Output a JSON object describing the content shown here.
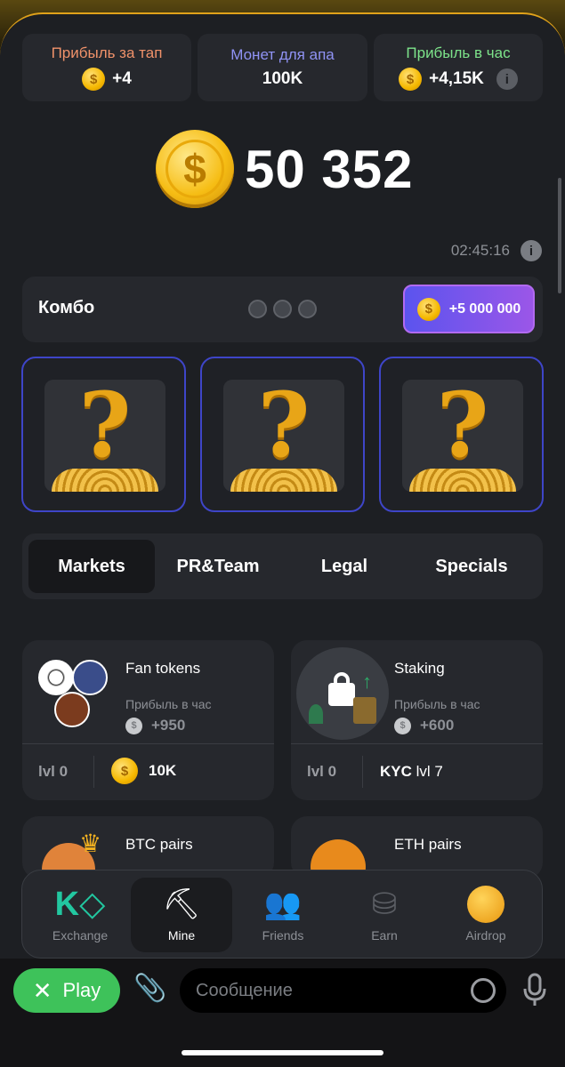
{
  "stats": [
    {
      "title": "Прибыль за тап",
      "value": "+4",
      "color": "#f0926a",
      "has_coin": true
    },
    {
      "title": "Монет для апа",
      "value": "100K",
      "color": "#9093f5",
      "has_coin": false
    },
    {
      "title": "Прибыль в час",
      "value": "+4,15K",
      "color": "#7de38a",
      "has_coin": true,
      "has_info": true
    }
  ],
  "balance": {
    "value": "50 352",
    "coin_symbol": "$"
  },
  "timer": {
    "value": "02:45:16",
    "info_icon": "i"
  },
  "combo": {
    "label": "Комбо",
    "reward": "+5 000 000",
    "slots_filled": 0,
    "slots_total": 3
  },
  "combo_cards": [
    {
      "symbol": "?"
    },
    {
      "symbol": "?"
    },
    {
      "symbol": "?"
    }
  ],
  "tabs": [
    {
      "label": "Markets",
      "active": true
    },
    {
      "label": "PR&Team",
      "active": false
    },
    {
      "label": "Legal",
      "active": false
    },
    {
      "label": "Specials",
      "active": false
    }
  ],
  "market_cards": [
    {
      "title": "Fan tokens",
      "profit_label": "Прибыль в час",
      "profit": "+950",
      "level": "lvl 0",
      "cost": "10K",
      "cost_type": "coin"
    },
    {
      "title": "Staking",
      "profit_label": "Прибыль в час",
      "profit": "+600",
      "level": "lvl 0",
      "requirement_bold": "KYC",
      "requirement": " lvl 7",
      "cost_type": "requirement"
    },
    {
      "title": "BTC pairs"
    },
    {
      "title": "ETH pairs"
    }
  ],
  "nav": [
    {
      "label": "Exchange",
      "icon": "exchange-icon",
      "active": false
    },
    {
      "label": "Mine",
      "icon": "pickaxe-icon",
      "active": true
    },
    {
      "label": "Friends",
      "icon": "friends-icon",
      "active": false
    },
    {
      "label": "Earn",
      "icon": "coins-stack-icon",
      "active": false
    },
    {
      "label": "Airdrop",
      "icon": "hamster-coin-icon",
      "active": false
    }
  ],
  "telegram": {
    "play_label": "Play",
    "message_placeholder": "Сообщение"
  },
  "colors": {
    "accent": "#e0a21a",
    "combo_gradient_start": "#5b54ee",
    "combo_gradient_end": "#9b56e8",
    "play_green": "#3ec25a",
    "card_border": "#3e45c8"
  }
}
